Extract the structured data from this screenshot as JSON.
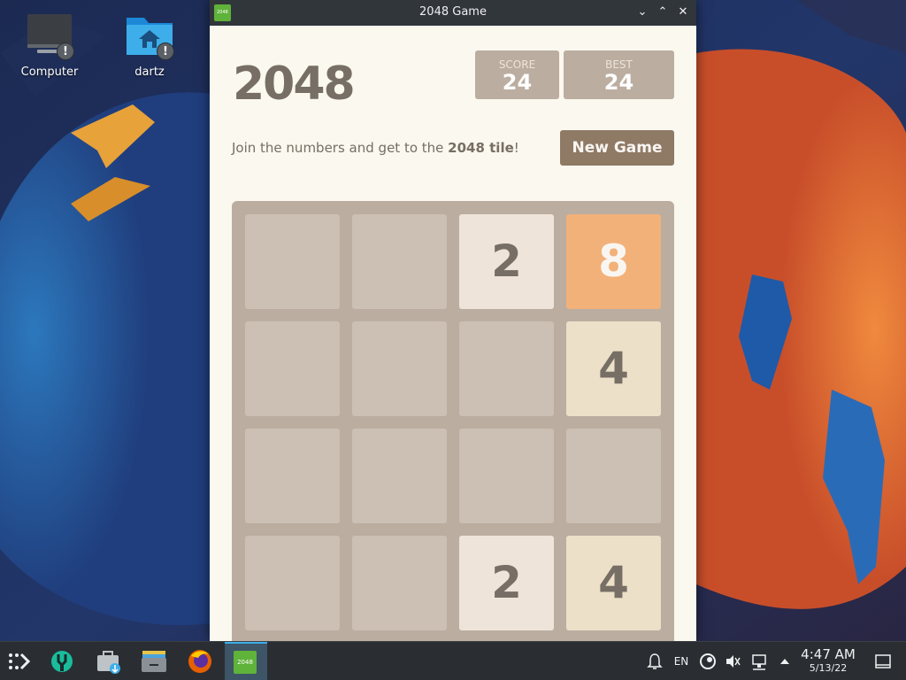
{
  "desktop": {
    "icons": [
      {
        "label": "Computer",
        "icon": "monitor-icon",
        "badge": "!"
      },
      {
        "label": "dartz",
        "icon": "home-folder-icon",
        "badge": "!"
      }
    ]
  },
  "window": {
    "title": "2048 Game",
    "app_icon_text": "2048",
    "controls": {
      "minimize": "⌄",
      "maximize": "⌃",
      "close": "✕"
    }
  },
  "game": {
    "heading": "2048",
    "score_label": "SCORE",
    "score": "24",
    "best_label": "BEST",
    "best": "24",
    "intro_prefix": "Join the numbers and get to the ",
    "intro_bold": "2048 tile",
    "intro_suffix": "!",
    "new_game": "New Game",
    "grid": [
      [
        null,
        null,
        2,
        8
      ],
      [
        null,
        null,
        null,
        4
      ],
      [
        null,
        null,
        null,
        null
      ],
      [
        null,
        null,
        2,
        4
      ]
    ],
    "tile_colors": {
      "2": "#eee4da",
      "4": "#ede0c8",
      "8": "#f2b179"
    }
  },
  "taskbar": {
    "items": [
      "app-launcher-icon",
      "discover-icon",
      "store-icon",
      "file-manager-icon",
      "firefox-icon",
      "2048-game-icon"
    ],
    "active_app_icon_text": "2048",
    "tray": {
      "language": "EN"
    },
    "clock": {
      "time": "4:47 AM",
      "date": "5/13/22"
    }
  },
  "colors": {
    "board": "#bbada0",
    "background": "#faf8ef",
    "text": "#776e65",
    "button": "#8f7a66",
    "accent": "#3daee9"
  }
}
